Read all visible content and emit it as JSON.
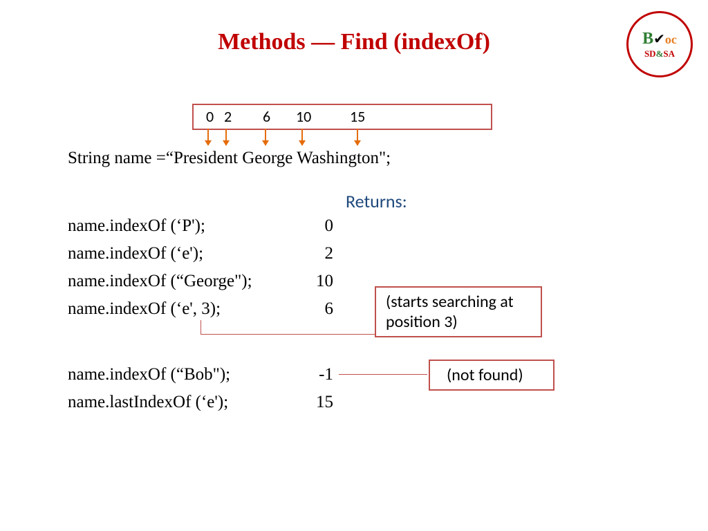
{
  "title": "Methods — Find (indexOf)",
  "logo": {
    "bvoc": "BVoc",
    "sub": "SD&SA"
  },
  "indexBox": {
    "nums": [
      "0",
      "2",
      "6",
      "10",
      "15"
    ]
  },
  "code": {
    "decl": "String name =“President George Washington\";",
    "returnsHeader": "Returns:",
    "rows": [
      {
        "call": "name.indexOf (‘P');",
        "ret": "0"
      },
      {
        "call": "name.indexOf (‘e');",
        "ret": "2"
      },
      {
        "call": "name.indexOf (“George\");",
        "ret": "10"
      },
      {
        "call": "name.indexOf (‘e', 3);",
        "ret": "6"
      },
      {
        "call": "name.indexOf (“Bob\");",
        "ret": "-1"
      },
      {
        "call": "name.lastIndexOf (‘e');",
        "ret": "15"
      }
    ]
  },
  "callouts": {
    "starts": "(starts searching at position 3)",
    "notfound": "(not found)"
  }
}
